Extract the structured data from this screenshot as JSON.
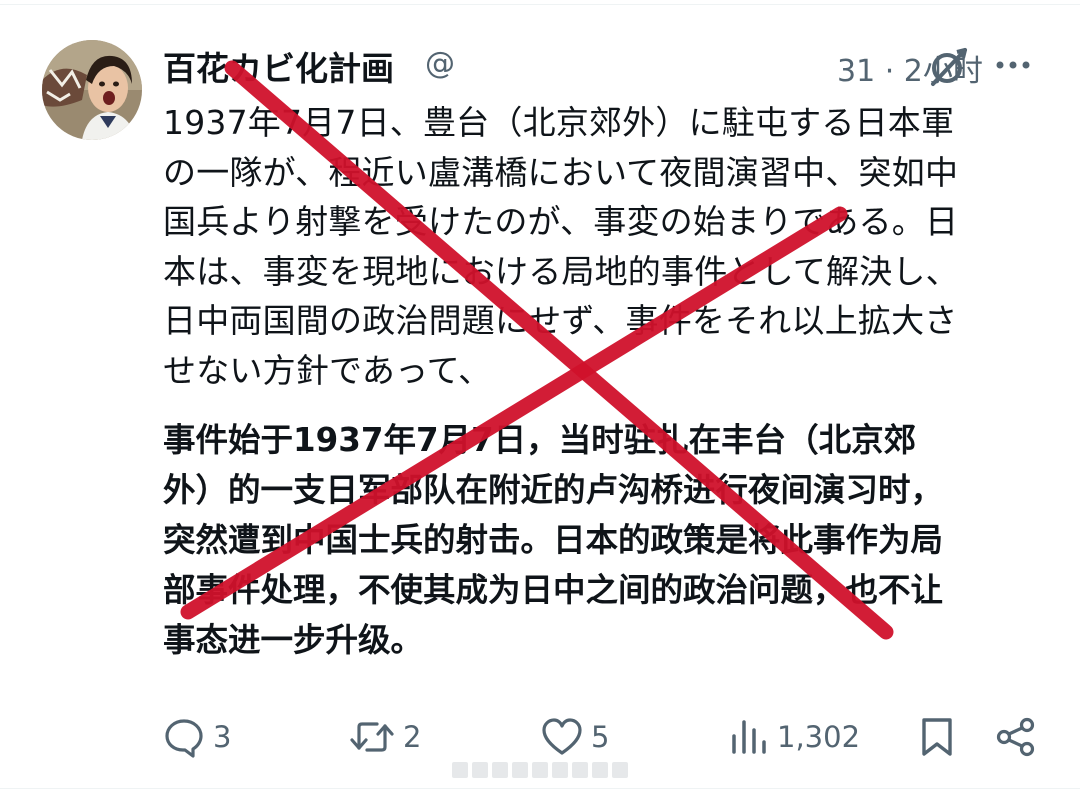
{
  "user": {
    "display_name": "百花カビ化計画",
    "handle_fragment": "@",
    "time_text": "31 · 2小时"
  },
  "tweet": {
    "text_japanese": "1937年7月7日、豊台（北京郊外）に駐屯する日本軍\nの一隊が、程近い盧溝橋において夜間演習中、突如中\n国兵より射撃を受けたのが、事変の始まりである。日\n本は、事変を現地における局地的事件として解決し、\n日中両国間の政治問題にせず、事件をそれ以上拡大さ\nせない方針であって、",
    "text_chinese": "事件始于1937年7月7日，当时驻扎在丰台（北京郊\n外）的一支日军部队在附近的卢沟桥进行夜间演习时，\n突然遭到中国士兵的射击。日本的政策是将此事作为局\n部事件处理，不使其成为日中之间的政治问题，也不让\n事态进一步升级。"
  },
  "actions": {
    "reply_count": "3",
    "retweet_count": "2",
    "like_count": "5",
    "view_count": "1,302"
  },
  "colors": {
    "cross": "#d0112b",
    "text": "#0f1419",
    "muted": "#536471"
  },
  "icons": {
    "header": [
      "grok-icon",
      "more-icon"
    ],
    "actions": [
      "reply-icon",
      "retweet-icon",
      "like-icon",
      "views-icon",
      "bookmark-icon",
      "share-icon"
    ]
  }
}
